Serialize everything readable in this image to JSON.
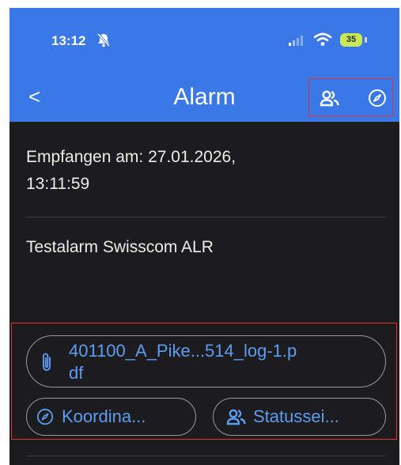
{
  "status_bar": {
    "time": "13:12",
    "battery_level": "35",
    "icons": [
      "bell-slash-icon",
      "signal-icon",
      "wifi-icon",
      "battery-icon"
    ]
  },
  "nav": {
    "title": "Alarm",
    "back_label": "<",
    "action_icons": [
      "people-icon",
      "compass-icon"
    ]
  },
  "alarm": {
    "received_label": "Empfangen am: 27.01.2026,",
    "received_time": "13:11:59",
    "message": "Testalarm Swisscom ALR"
  },
  "attachments": {
    "file_line1": "401100_A_Pike...514_log-1.p",
    "file_line2": "df",
    "coords_label": "Koordina...",
    "status_label": "Statussei..."
  },
  "colors": {
    "header_blue": "#3b78e7",
    "background": "#1c1c1e",
    "link_blue": "#5d9cf2",
    "highlight_red": "#e0303a"
  }
}
